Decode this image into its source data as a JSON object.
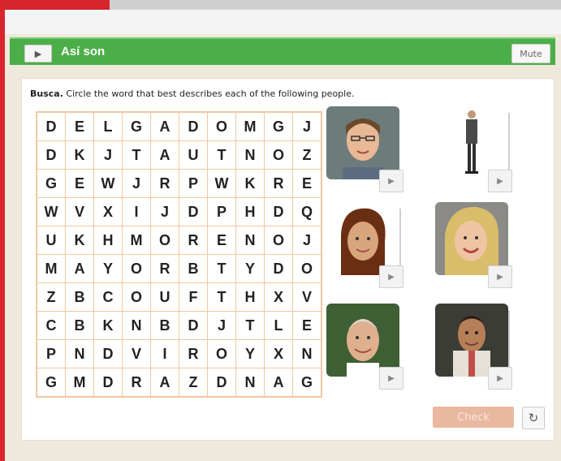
{
  "header": {
    "title": "Así son",
    "mute_label": "Mute"
  },
  "instruction": {
    "lead": "Busca.",
    "text": "Circle the word that best describes each of the following people."
  },
  "grid": [
    [
      "D",
      "E",
      "L",
      "G",
      "A",
      "D",
      "O",
      "M",
      "G",
      "J"
    ],
    [
      "D",
      "K",
      "J",
      "T",
      "A",
      "U",
      "T",
      "N",
      "O",
      "Z"
    ],
    [
      "G",
      "E",
      "W",
      "J",
      "R",
      "P",
      "W",
      "K",
      "R",
      "E"
    ],
    [
      "W",
      "V",
      "X",
      "I",
      "J",
      "D",
      "P",
      "H",
      "D",
      "Q"
    ],
    [
      "U",
      "K",
      "H",
      "M",
      "O",
      "R",
      "E",
      "N",
      "O",
      "J"
    ],
    [
      "M",
      "A",
      "Y",
      "O",
      "R",
      "B",
      "T",
      "Y",
      "D",
      "O"
    ],
    [
      "Z",
      "B",
      "C",
      "O",
      "U",
      "F",
      "T",
      "H",
      "X",
      "V"
    ],
    [
      "C",
      "B",
      "K",
      "N",
      "B",
      "D",
      "J",
      "T",
      "L",
      "E"
    ],
    [
      "P",
      "N",
      "D",
      "V",
      "I",
      "R",
      "O",
      "Y",
      "X",
      "N"
    ],
    [
      "G",
      "M",
      "D",
      "R",
      "A",
      "Z",
      "D",
      "N",
      "A",
      "G"
    ]
  ],
  "people": [
    {
      "icon": "person-icon"
    },
    {
      "icon": "person-icon"
    },
    {
      "icon": "person-icon"
    },
    {
      "icon": "person-icon"
    },
    {
      "icon": "person-icon"
    },
    {
      "icon": "person-icon"
    }
  ],
  "actions": {
    "check_label": "Check",
    "reset_icon": "↻"
  },
  "colors": {
    "accent": "#4cae48",
    "brand_red": "#d8242d",
    "grid_border": "#f2c7a0",
    "check_disabled": "#e8b89f"
  }
}
